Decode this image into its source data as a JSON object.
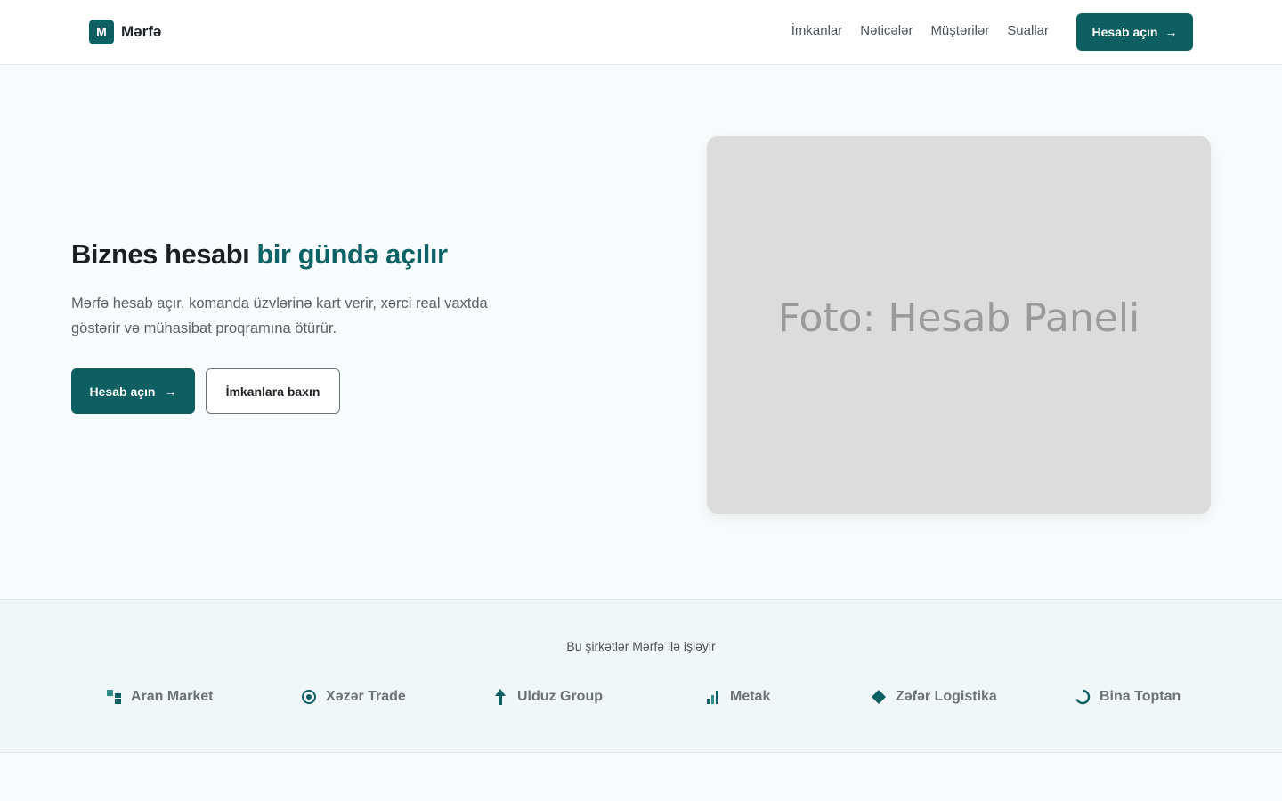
{
  "header": {
    "logo_letter": "M",
    "brand": "Mərfə",
    "nav": [
      "İmkanlar",
      "Nəticələr",
      "Müştərilər",
      "Suallar"
    ],
    "cta_label": "Hesab açın"
  },
  "hero": {
    "title_plain": "Biznes hesabı ",
    "title_accent": "bir gündə açılır",
    "subtitle": "Mərfə hesab açır, komanda üzvlərinə kart verir, xərci real vaxtda göstərir və mühasibat proqramına ötürür.",
    "primary_label": "Hesab açın",
    "secondary_label": "İmkanlara baxın",
    "image_label": "Foto: Hesab Paneli"
  },
  "partners": {
    "title": "Bu şirkətlər Mərfə ilə işləyir",
    "companies": [
      {
        "name": "Aran Market",
        "icon": "grid-squares-icon"
      },
      {
        "name": "Xəzər Trade",
        "icon": "target-icon"
      },
      {
        "name": "Ulduz Group",
        "icon": "arrow-up-icon"
      },
      {
        "name": "Metak",
        "icon": "bar-chart-icon"
      },
      {
        "name": "Zəfər Logistika",
        "icon": "diamond-icon"
      },
      {
        "name": "Bina Toptan",
        "icon": "refresh-arc-icon"
      }
    ]
  },
  "colors": {
    "brand": "#0d5f62",
    "accent_text": "#0d6265",
    "page_bg": "#f8fbfc",
    "strip_bg": "#f1f6f8"
  }
}
